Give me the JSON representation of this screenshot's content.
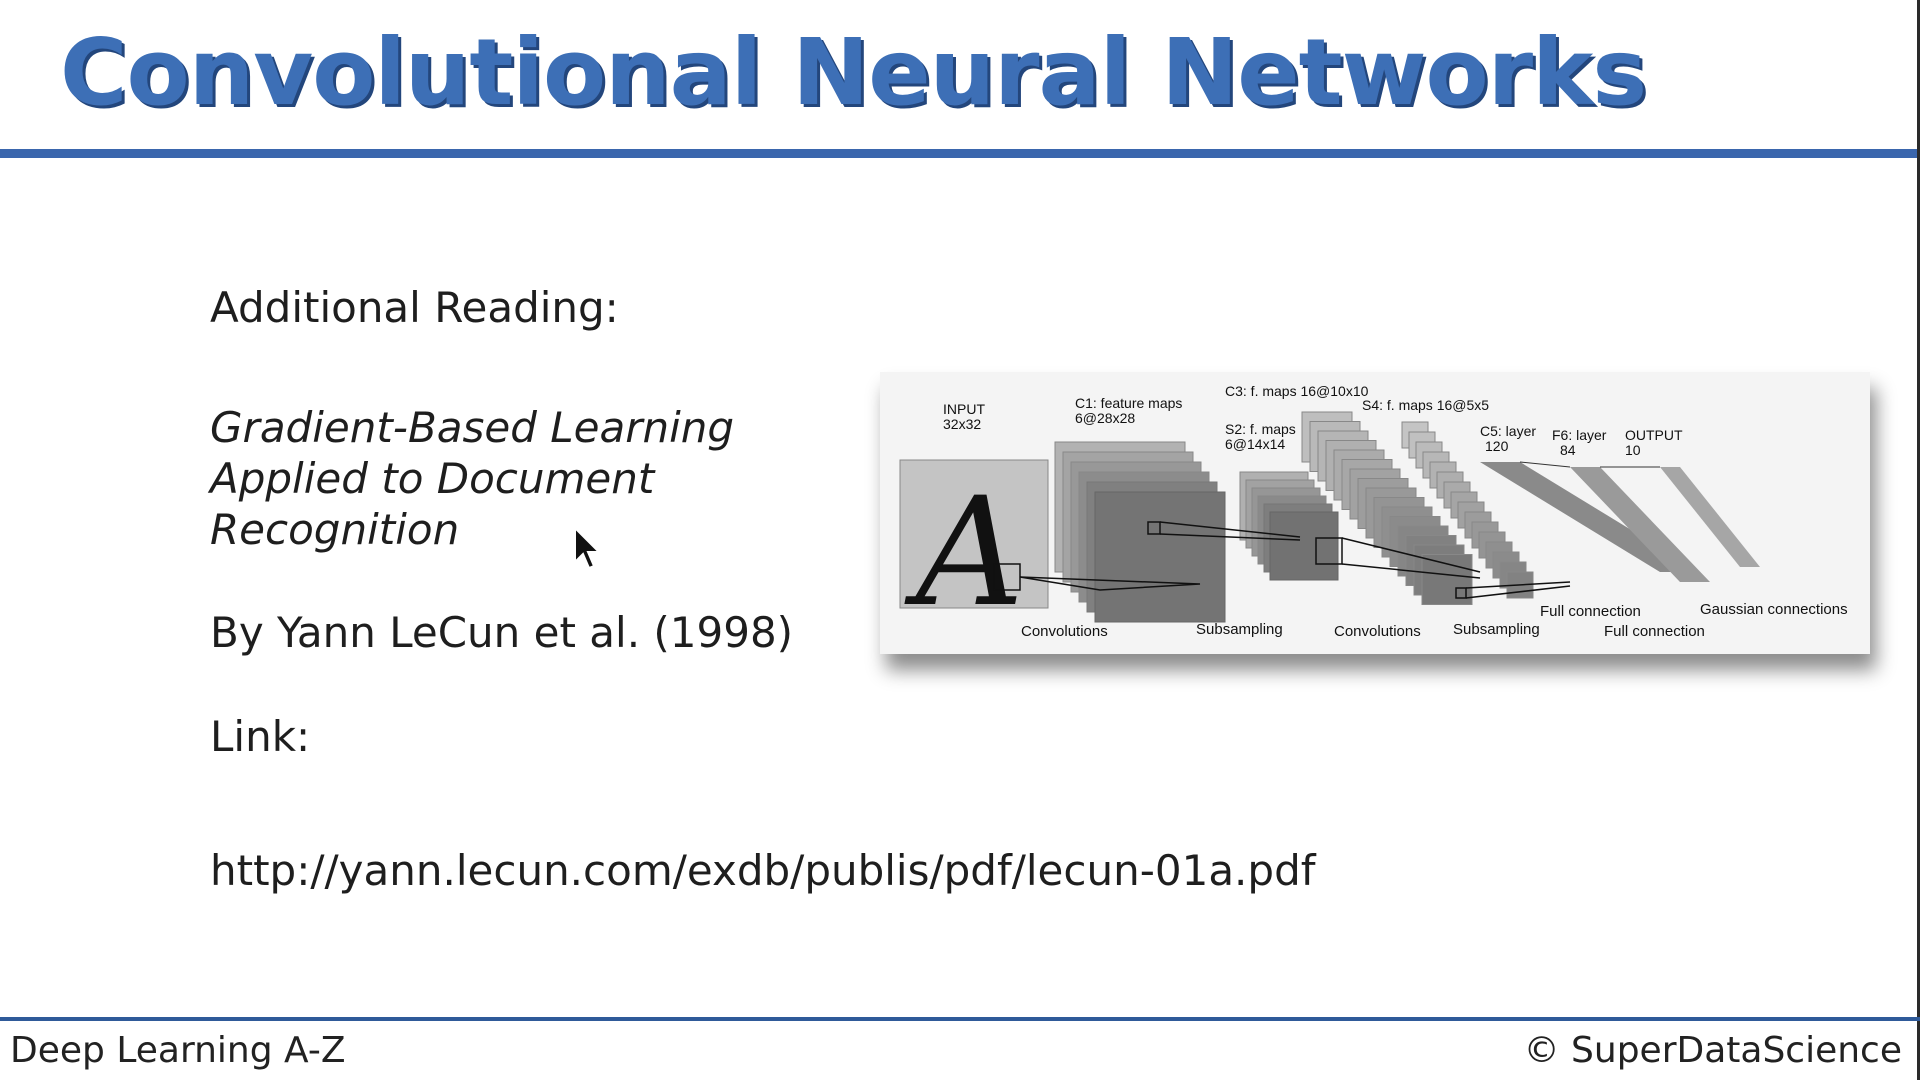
{
  "slide": {
    "title": "Convolutional Neural Networks",
    "heading": "Additional Reading:",
    "paper_title_lines": [
      "Gradient-Based Learning",
      "Applied to Document",
      "Recognition"
    ],
    "author": "By Yann LeCun et al. (1998)",
    "link_label": "Link:",
    "link_url": "http://yann.lecun.com/exdb/publis/pdf/lecun-01a.pdf"
  },
  "figure": {
    "input_label": [
      "INPUT",
      "32x32"
    ],
    "c1_label": [
      "C1: feature maps",
      "6@28x28"
    ],
    "s2_label": [
      "S2: f. maps",
      "6@14x14"
    ],
    "c3_label": "C3: f. maps 16@10x10",
    "s4_label": "S4: f. maps 16@5x5",
    "c5_label": [
      "C5: layer",
      "120"
    ],
    "f6_label": [
      "F6: layer",
      "84"
    ],
    "output_label": [
      "OUTPUT",
      "10"
    ],
    "operations": [
      "Convolutions",
      "Subsampling",
      "Convolutions",
      "Subsampling",
      "Full connection",
      "Full connection",
      "Gaussian connections"
    ],
    "input_glyph": "A"
  },
  "footer": {
    "course": "Deep Learning A-Z",
    "brand": "© SuperDataScience"
  },
  "colors": {
    "title_blue": "#3d6fb6",
    "rule_blue": "#3a66ad",
    "text": "#1e1e1e"
  }
}
